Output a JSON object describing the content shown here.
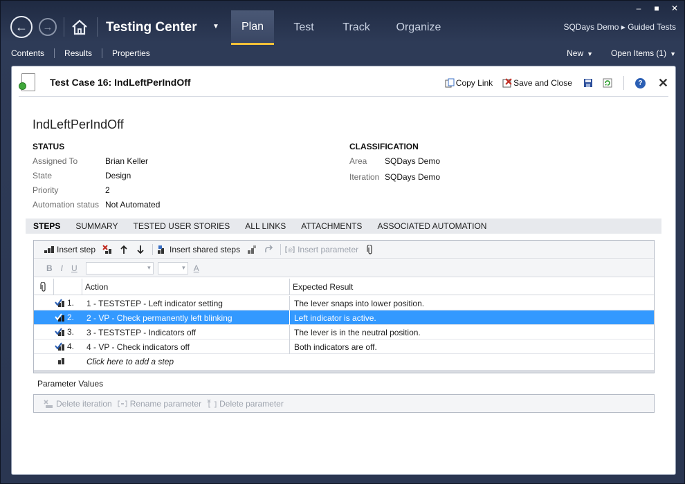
{
  "window": {
    "minimize": "‒",
    "maximize": "■",
    "close": "✕"
  },
  "nav": {
    "back_glyph": "←",
    "forward_glyph": "→",
    "app_title": "Testing Center",
    "app_dropdown": "▼",
    "tabs": [
      "Plan",
      "Test",
      "Track",
      "Organize"
    ],
    "active_tab": "Plan",
    "breadcrumb": "SQDays Demo ▸ Guided Tests"
  },
  "subnav": {
    "left": [
      "Contents",
      "Results",
      "Properties"
    ],
    "new_label": "New",
    "open_items_label": "Open Items (1)"
  },
  "document": {
    "title": "Test Case 16: IndLeftPerIndOff",
    "copy_link": "Copy Link",
    "save_close": "Save and Close",
    "help": "?",
    "close": "✕"
  },
  "testcase": {
    "name": "IndLeftPerIndOff",
    "status_heading": "STATUS",
    "classification_heading": "CLASSIFICATION",
    "status_fields": [
      {
        "label": "Assigned To",
        "value": "Brian Keller"
      },
      {
        "label": "State",
        "value": "Design"
      },
      {
        "label": "Priority",
        "value": "2"
      },
      {
        "label": "Automation status",
        "value": "Not Automated"
      }
    ],
    "classification_fields": [
      {
        "label": "Area",
        "value": "SQDays Demo"
      },
      {
        "label": "Iteration",
        "value": "SQDays Demo"
      }
    ]
  },
  "tabs": [
    "STEPS",
    "SUMMARY",
    "TESTED USER STORIES",
    "ALL LINKS",
    "ATTACHMENTS",
    "ASSOCIATED AUTOMATION"
  ],
  "steps_toolbar": {
    "insert_step": "Insert step",
    "insert_shared_steps": "Insert shared steps",
    "insert_parameter": "Insert parameter",
    "bold": "B",
    "italic": "I",
    "underline": "U",
    "font_color": "A"
  },
  "grid": {
    "col_action": "Action",
    "col_expected": "Expected Result",
    "rows": [
      {
        "num": "1.",
        "action": "1 - TESTSTEP - Left indicator setting",
        "expected": "The lever snaps into lower position.",
        "selected": false
      },
      {
        "num": "2.",
        "action": "2 - VP - Check permanently left blinking",
        "expected": "Left indicator is active.",
        "selected": true
      },
      {
        "num": "3.",
        "action": "3 - TESTSTEP - Indicators off",
        "expected": "The lever is in the neutral position.",
        "selected": false
      },
      {
        "num": "4.",
        "action": "4 - VP - Check indicators off",
        "expected": "Both indicators are off.",
        "selected": false
      }
    ],
    "add_step": "Click here to add a step"
  },
  "parameters": {
    "label": "Parameter Values",
    "delete_iteration": "Delete iteration",
    "rename_parameter": "Rename parameter",
    "delete_parameter": "Delete parameter"
  }
}
